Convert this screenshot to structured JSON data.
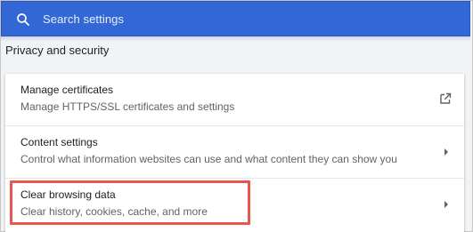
{
  "search": {
    "placeholder": "Search settings",
    "icon": "search-icon"
  },
  "section": {
    "title": "Privacy and security"
  },
  "rows": [
    {
      "title": "Manage certificates",
      "subtitle": "Manage HTTPS/SSL certificates and settings",
      "icon": "external-link-icon"
    },
    {
      "title": "Content settings",
      "subtitle": "Control what information websites can use and what content they can show you",
      "icon": "chevron-right-icon"
    },
    {
      "title": "Clear browsing data",
      "subtitle": "Clear history, cookies, cache, and more",
      "icon": "chevron-right-icon"
    }
  ],
  "colors": {
    "header": "#3367d6",
    "highlight": "#e8574f",
    "background": "#f1f3f4"
  }
}
